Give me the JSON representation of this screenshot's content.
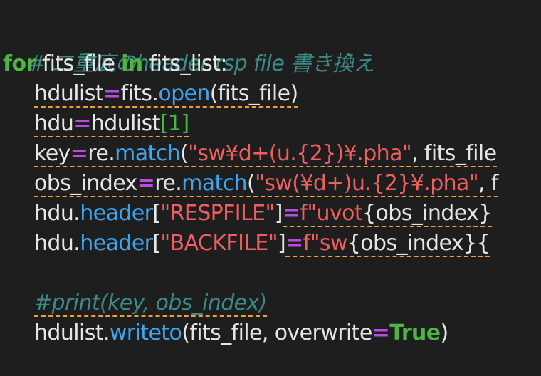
{
  "code": {
    "line1_comment": "# 二重底のheader rsp file 書き換え",
    "line2": {
      "kw_for": "for",
      "var": " fits_file ",
      "kw_in": "in",
      "iter": " fits_list:"
    },
    "line3": {
      "lhs": "hdulist",
      "op": "=",
      "obj": "fits",
      "dot": ".",
      "fn": "open",
      "args": "(fits_file)"
    },
    "line4": {
      "lhs": "hdu",
      "op": "=",
      "obj": "hdulist",
      "open": "[",
      "idx": "1",
      "close": "]"
    },
    "line5": {
      "lhs": "key",
      "op": "=",
      "obj": "re",
      "dot": ".",
      "fn": "match",
      "paren": "(",
      "str": "\"sw¥d+(u.{2})¥.pha\"",
      "rest": ", fits_file"
    },
    "line6": {
      "lhs": "obs_index",
      "op": "=",
      "obj": "re",
      "dot": ".",
      "fn": "match",
      "paren": "(",
      "str": "\"sw(¥d+)u.{2}¥.pha\"",
      "rest": ", f"
    },
    "line7": {
      "obj": "hdu",
      "dot": ".",
      "attr": "header",
      "open": "[",
      "str": "\"RESPFILE\"",
      "close": "]",
      "op": "=",
      "fpre": "f",
      "fstr": "\"uvot",
      "brace": "{obs_index}"
    },
    "line8": {
      "obj": "hdu",
      "dot": ".",
      "attr": "header",
      "open": "[",
      "str": "\"BACKFILE\"",
      "close": "]",
      "op": "=",
      "fpre": "f",
      "fstr": "\"sw",
      "brace": "{obs_index}{"
    },
    "line10_comment": "#print(key, obs_index)",
    "line11": {
      "obj": "hdulist",
      "dot": ".",
      "fn": "writeto",
      "args1": "(fits_file, overwrite",
      "op": "=",
      "bool": "True",
      "close": ")"
    }
  },
  "colors": {
    "background": "#1e1e1e",
    "comment": "#3b8a83",
    "keyword": "#4fb542",
    "function": "#3ea4ee",
    "string": "#f05f5f",
    "operator": "#b84ce0",
    "warning_underline": "#f0a030"
  }
}
